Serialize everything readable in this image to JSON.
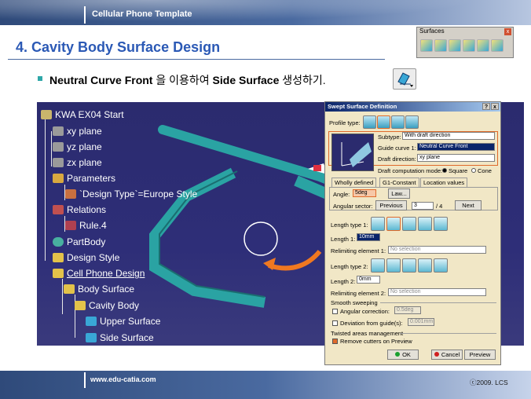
{
  "header": {
    "title": "Cellular Phone Template"
  },
  "page_title": "4. Cavity Body Surface Design",
  "toolbar": {
    "title": "Surfaces",
    "close": "x",
    "icons": [
      "extrude-icon",
      "revolve-icon",
      "sphere-icon",
      "cylinder-icon",
      "sweep-icon",
      "fill-icon",
      "blend-icon"
    ]
  },
  "subheading": {
    "part1": "Neutral Curve Front ",
    "part2": "을 이용하여 ",
    "part3": "Side Surface ",
    "part4": "생성하기."
  },
  "tree": {
    "root": "KWA EX04 Start",
    "items": [
      "xy plane",
      "yz plane",
      "zx plane",
      "Parameters",
      "`Design Type`=Europe Style",
      "Relations",
      "Rule.4",
      "PartBody",
      "Design Style",
      "Cell Phone Design",
      "Body Surface",
      "Cavity Body",
      "Upper Surface",
      "Side Surface"
    ]
  },
  "dialog": {
    "title": "Swept Surface Definition",
    "help": "?",
    "close": "x",
    "profile_type_label": "Profile type:",
    "subtype_label": "Subtype:",
    "subtype_value": "With draft direction",
    "guide_label": "Guide curve 1:",
    "guide_value": "Neutral Curve Front",
    "draft_dir_label": "Draft direction:",
    "draft_dir_value": "xy plane",
    "draft_mode_label": "Draft computation mode:",
    "mode_square": "Square",
    "mode_cone": "Cone",
    "tabs": [
      "Wholly defined",
      "G1-Constant",
      "Location values"
    ],
    "angle_label": "Angle:",
    "angle_value": "5deg",
    "law_button": "Law...",
    "angular_sector_label": "Angular sector:",
    "previous_button": "Previous",
    "sector_value": "3",
    "sector_total": "/ 4",
    "next_button": "Next",
    "length_type1_label": "Length type 1:",
    "length1_label": "Length 1:",
    "length1_value": "10mm",
    "relim1_label": "Relimiting element 1:",
    "relim1_value": "No selection",
    "length_type2_label": "Length type 2:",
    "length2_label": "Length 2:",
    "length2_value": "0mm",
    "relim2_label": "Relimiting element 2:",
    "relim2_value": "No selection",
    "smooth_label": "Smooth sweeping",
    "angular_corr_label": "Angular correction:",
    "angular_corr_value": "0.5deg",
    "deviation_label": "Deviation from guide(s):",
    "deviation_value": "0.001mm",
    "twisted_label": "Twisted areas management",
    "remove_cutters_label": "Remove cutters on Preview",
    "ok_button": "OK",
    "cancel_button": "Cancel",
    "preview_button": "Preview"
  },
  "footer": {
    "url": "www.edu-catia.com",
    "copyright": "ⓒ2009. LCS"
  }
}
